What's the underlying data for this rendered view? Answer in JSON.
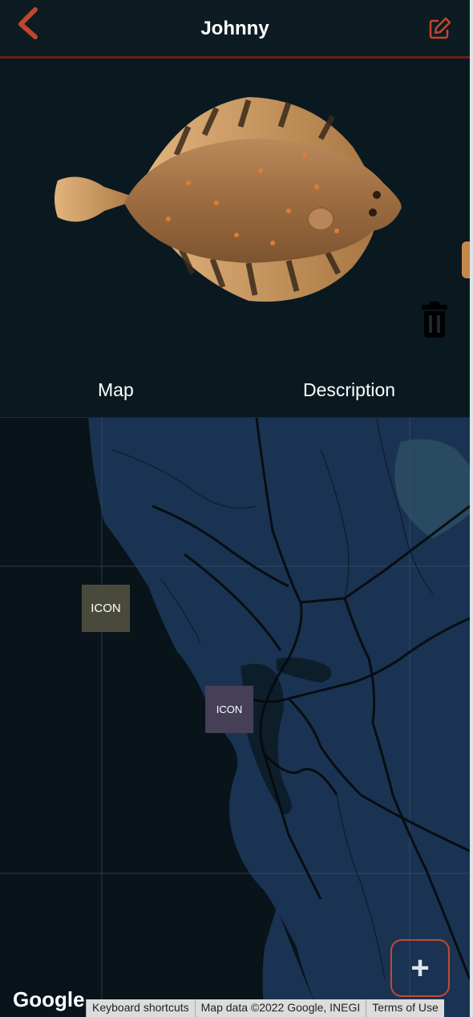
{
  "header": {
    "title": "Johnny",
    "back_icon": "chevron-left-icon",
    "edit_icon": "edit-icon",
    "accent_color": "#c2462c"
  },
  "carousel": {
    "image": "flounder-fish",
    "delete_icon": "trash-icon"
  },
  "tabs": [
    {
      "label": "Map"
    },
    {
      "label": "Description"
    }
  ],
  "map": {
    "markers": [
      {
        "label": "ICON"
      },
      {
        "label": "ICON"
      }
    ],
    "add_button": "+",
    "google_logo": "Google",
    "attribution": {
      "shortcuts": "Keyboard shortcuts",
      "data": "Map data ©2022 Google, INEGI",
      "terms": "Terms of Use"
    }
  }
}
